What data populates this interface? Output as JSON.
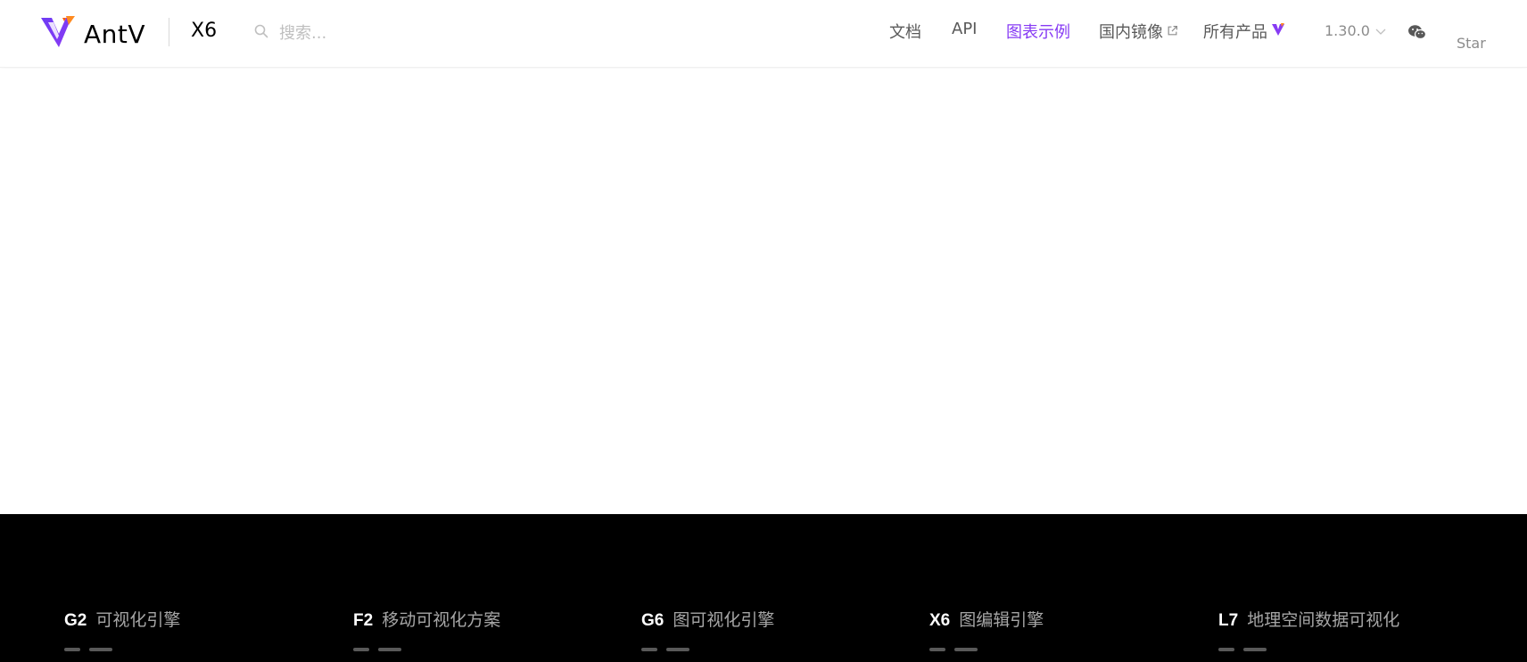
{
  "header": {
    "logo_text": "AntV",
    "product": "X6",
    "search": {
      "placeholder": "搜索..."
    },
    "nav": {
      "docs": "文档",
      "api": "API",
      "examples": "图表示例",
      "mirror": "国内镜像",
      "products": "所有产品"
    },
    "version": "1.30.0",
    "star": "Star",
    "active_color": "#873bf4"
  },
  "footer": {
    "products": [
      {
        "name": "G2",
        "desc": "可视化引擎"
      },
      {
        "name": "F2",
        "desc": "移动可视化方案"
      },
      {
        "name": "G6",
        "desc": "图可视化引擎"
      },
      {
        "name": "X6",
        "desc": "图编辑引擎"
      },
      {
        "name": "L7",
        "desc": "地理空间数据可视化"
      }
    ]
  },
  "icons": {
    "logo": "antv-logo-icon",
    "search": "search-icon",
    "external_link": "external-link-icon",
    "products": "antv-triangle-icon",
    "version_dropdown": "chevron-down-icon",
    "wechat": "wechat-icon"
  }
}
